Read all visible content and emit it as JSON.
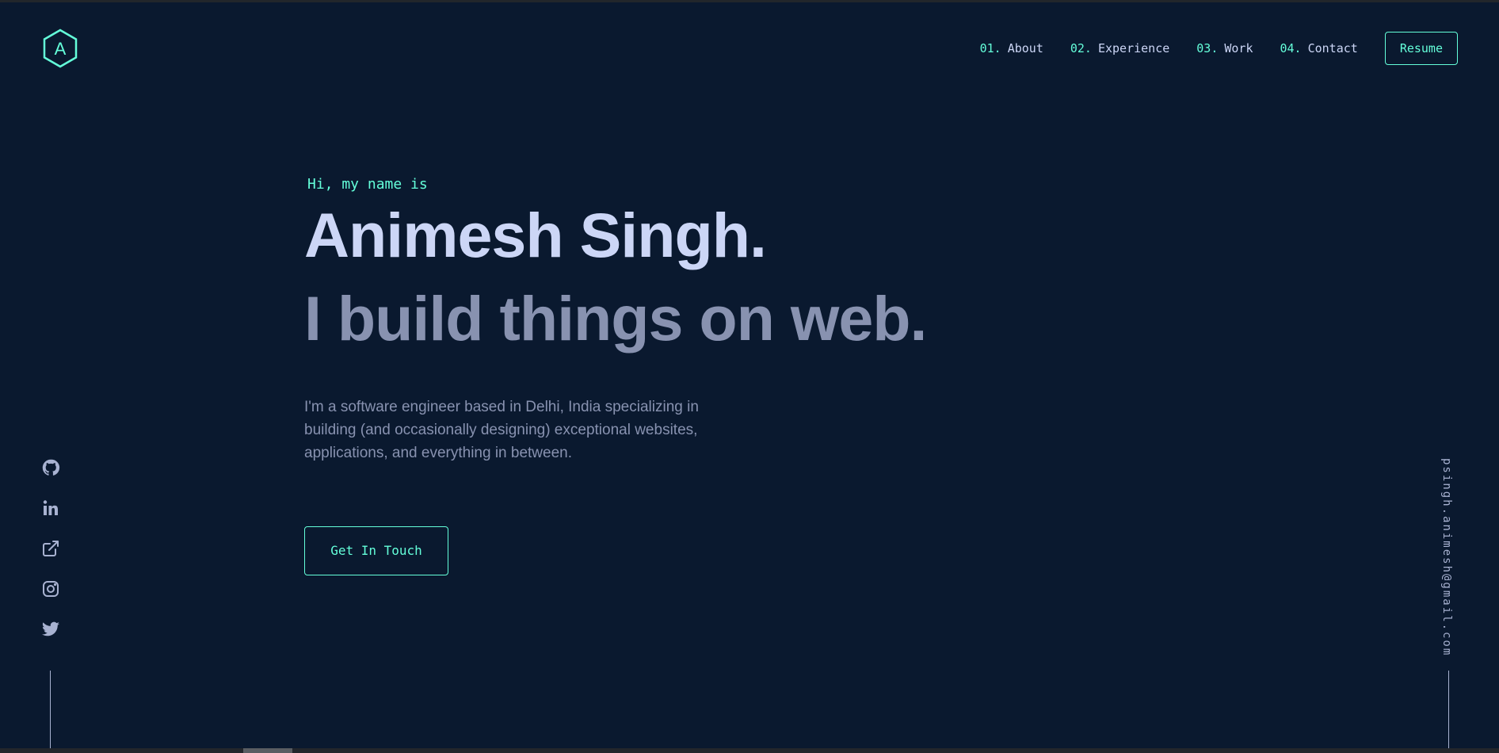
{
  "colors": {
    "background": "#0a192f",
    "accent": "#64ffda",
    "lightest_slate": "#ccd6f6",
    "slate": "#8892b0",
    "light_slate": "#a8b2d1"
  },
  "logo": {
    "letter": "A",
    "icon": "hexagon-logo-icon"
  },
  "nav": {
    "items": [
      {
        "num": "01.",
        "label": "About"
      },
      {
        "num": "02.",
        "label": "Experience"
      },
      {
        "num": "03.",
        "label": "Work"
      },
      {
        "num": "04.",
        "label": "Contact"
      }
    ],
    "resume_label": "Resume"
  },
  "hero": {
    "greeting": "Hi, my name is",
    "name": "Animesh Singh.",
    "tagline": "I build things on web.",
    "bio": "I'm a software engineer based in Delhi, India specializing in building (and occasionally designing) exceptional websites, applications, and everything in between.",
    "cta_label": "Get In Touch"
  },
  "social": {
    "icons": [
      "github-icon",
      "linkedin-icon",
      "external-link-icon",
      "instagram-icon",
      "twitter-icon"
    ]
  },
  "email": "psingh.animesh@gmail.com"
}
